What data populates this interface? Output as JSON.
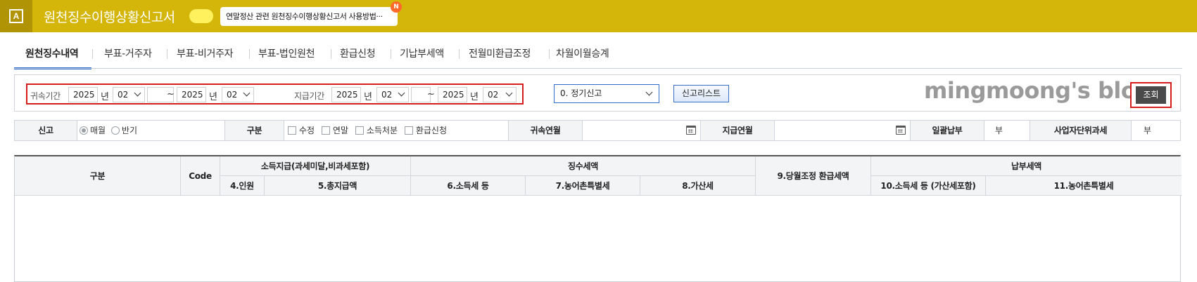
{
  "titlebar": {
    "app_badge": "A",
    "title": "원천징수이행상황신고서",
    "notice": "연말정산 관련 원천징수이행상황신고서 사용방법···",
    "new_badge": "N"
  },
  "tabs": [
    "원천징수내역",
    "부표-거주자",
    "부표-비거주자",
    "부표-법인원천",
    "환급신청",
    "기납부세액",
    "전월미환급조정",
    "차월이월승계"
  ],
  "filter": {
    "attribution_label": "귀속기간",
    "attr_from_year": "2025",
    "attr_from_month": "02",
    "attr_to_year": "2025",
    "attr_to_month": "02",
    "payment_label": "지급기간",
    "pay_from_year": "2025",
    "pay_from_month": "02",
    "pay_to_year": "2025",
    "pay_to_month": "02",
    "year_unit": "년",
    "range_sep": "~",
    "report_type": "0. 정기신고",
    "list_button": "신고리스트",
    "query_button": "조회"
  },
  "watermark": "mingmoong's blog",
  "options": {
    "report_label": "신고",
    "monthly": "매월",
    "half_year": "반기",
    "category_label": "구분",
    "chk_amend": "수정",
    "chk_yearend": "연말",
    "chk_income_disposal": "소득처분",
    "chk_refund": "환급신청",
    "attr_month_label": "귀속연월",
    "pay_month_label": "지급연월",
    "lump_label": "일괄납부",
    "lump_value": "부",
    "unit_tax_label": "사업자단위과세",
    "unit_tax_value": "부"
  },
  "grid": {
    "col_category": "구분",
    "col_code": "Code",
    "grp_income": "소득지급(과세미달,비과세포함)",
    "col_people": "4.인원",
    "col_total_pay": "5.총지급액",
    "grp_withheld": "징수세액",
    "col_income_tax": "6.소득세 등",
    "col_rural_tax": "7.농어촌특별세",
    "col_additional": "8.가산세",
    "col_monthly_refund": "9.당월조정 환급세액",
    "grp_payment": "납부세액",
    "col_pay_income_tax": "10.소득세 등 (가산세포함)",
    "col_pay_rural_tax": "11.농어촌특별세"
  }
}
